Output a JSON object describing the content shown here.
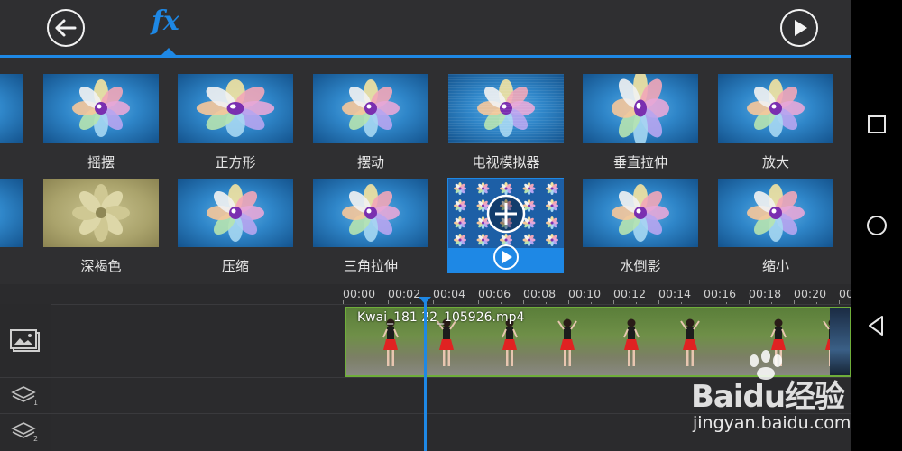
{
  "topbar": {
    "back_icon": "arrow-left-icon",
    "fx_label": "fx",
    "play_icon": "play-icon",
    "accent_color": "#1e88e5"
  },
  "effects": {
    "row1": [
      "",
      "摇摆",
      "正方形",
      "摆动",
      "电视模拟器",
      "垂直拉伸",
      "放大"
    ],
    "row2": [
      "",
      "深褐色",
      "压缩",
      "三角拉伸",
      "",
      "水倒影",
      "缩小"
    ],
    "selected_index_row2": 4,
    "selected_overlay_icon": "plus-circle-icon",
    "selected_preview_icon": "play-circle-icon"
  },
  "timeline": {
    "ticks": [
      "00:00",
      "00:02",
      "00:04",
      "00:06",
      "00:08",
      "00:10",
      "00:12",
      "00:14",
      "00:16",
      "00:18",
      "00:20",
      "00:"
    ],
    "clip_name": "Kwai_181  22_105926.mp4",
    "track_icons": [
      "image-track-icon",
      "layer-1-icon",
      "layer-2-icon"
    ],
    "layer_numbers": [
      "1",
      "2"
    ],
    "clip_border_color": "#6fae3a"
  },
  "watermark": {
    "logo": "Baidu经验",
    "url": "jingyan.baidu.com"
  },
  "navbar": {
    "icons": [
      "square-recents-icon",
      "circle-home-icon",
      "triangle-back-icon"
    ]
  }
}
